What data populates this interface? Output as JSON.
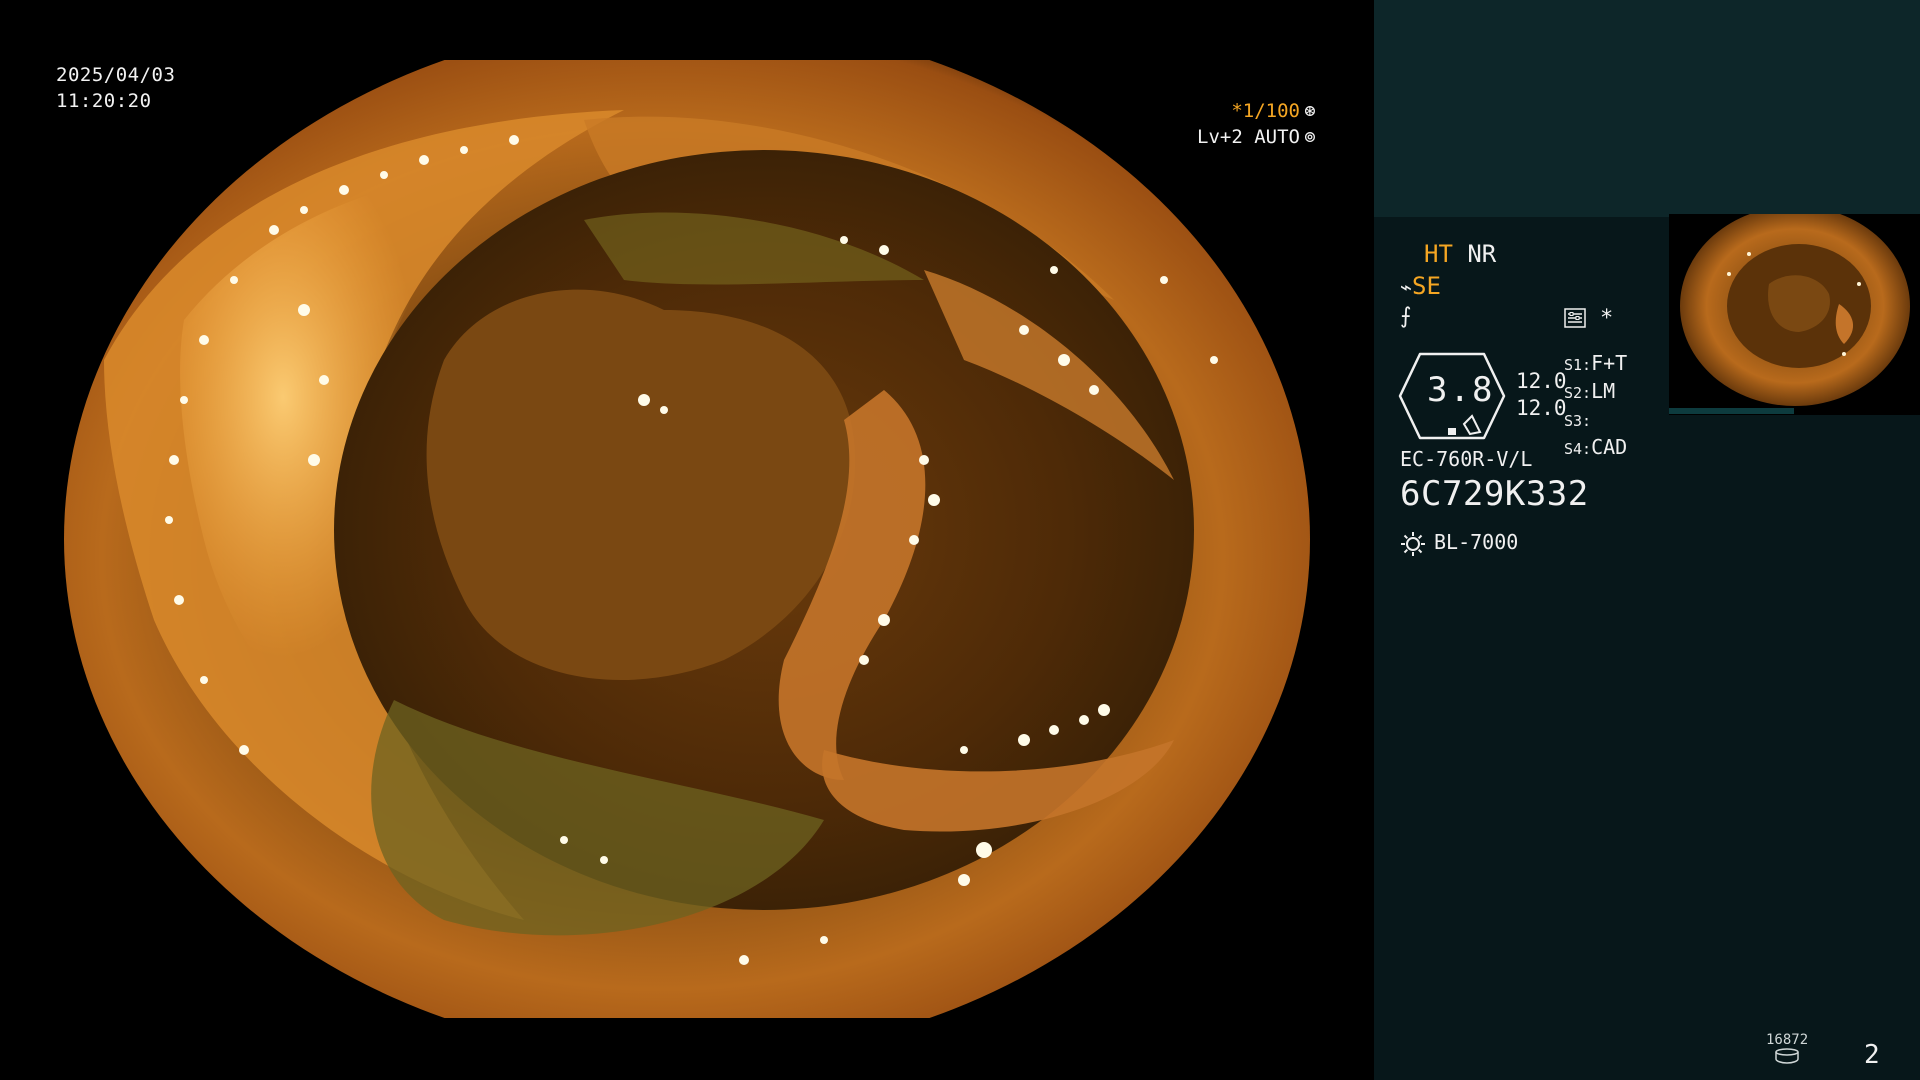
{
  "overlay": {
    "date": "2025/04/03",
    "time": "11:20:20",
    "shutter_speed": "*1/100",
    "shutter_icon": "aperture-icon",
    "iris_level": "Lv+2",
    "iris_mode": "AUTO",
    "iris_icon": "iris-icon"
  },
  "panel": {
    "enh_ht": "HT",
    "enh_nr": "NR",
    "se_label": "SE",
    "se_icon": "curve-icon",
    "f_icon": "f-slash-icon",
    "settings_icon": "settings-icon",
    "star": "*",
    "iris_value": "3.8",
    "val1": "12.0",
    "val2": "12.0",
    "switches": [
      {
        "key": "S1:",
        "value": "F+T"
      },
      {
        "key": "S2:",
        "value": "LM"
      },
      {
        "key": "S3:",
        "value": ""
      },
      {
        "key": "S4:",
        "value": "CAD"
      }
    ],
    "scope_model": "EC-760R-V/L",
    "scope_serial": "6C729K332",
    "light_icon": "sun-icon",
    "light_source": "BL-7000",
    "record_count": "16872",
    "disk_icon": "disk-icon",
    "page_number": "2"
  },
  "colors": {
    "accent_orange": "#f5a623",
    "panel_bg": "#07171a",
    "panel_top_bg": "#0d2629"
  }
}
